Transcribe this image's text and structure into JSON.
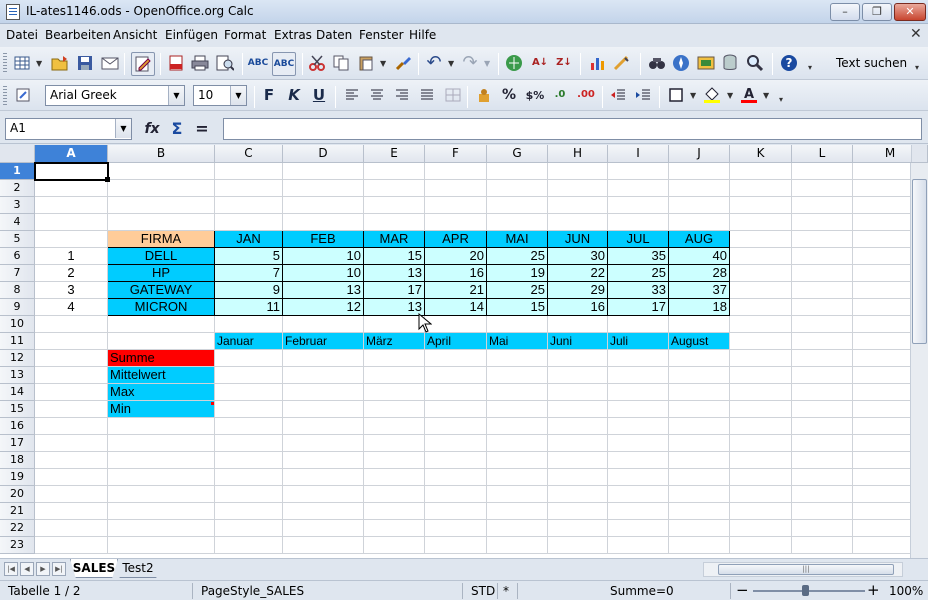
{
  "window": {
    "title": "IL-ates1146.ods - OpenOffice.org Calc",
    "minimize": "–",
    "maximize": "❐",
    "close": "✕"
  },
  "menu": {
    "items": [
      "Datei",
      "Bearbeiten",
      "Ansicht",
      "Einfügen",
      "Format",
      "Extras",
      "Daten",
      "Fenster",
      "Hilfe"
    ],
    "doc_close": "✕"
  },
  "toolbar1": {
    "find_label": "Text suchen",
    "icons": [
      "new-icon",
      "open-icon",
      "save-icon",
      "email-icon",
      "edit-file-icon",
      "export-pdf-icon",
      "print-icon",
      "page-preview-icon",
      "spellcheck-icon",
      "autospellcheck-icon",
      "cut-icon",
      "copy-icon",
      "paste-icon",
      "format-paintbrush-icon",
      "undo-icon",
      "redo-icon",
      "hyperlink-icon",
      "sort-ascending-icon",
      "sort-descending-icon",
      "chart-icon",
      "draw-functions-icon",
      "find-replace-icon",
      "navigator-icon",
      "gallery-icon",
      "data-sources-icon",
      "zoom-icon",
      "help-icon"
    ]
  },
  "toolbar2": {
    "font_name": "Arial Greek",
    "font_size": "10",
    "bold": "F",
    "italic": "K",
    "underline": "U",
    "percent": "%",
    "currency": "$%",
    "add_decimal": ".0",
    "del_decimal": ".00"
  },
  "formula_bar": {
    "name_box": "A1",
    "function_wizard": "fx",
    "sum": "Σ",
    "equals": "=",
    "input": ""
  },
  "grid": {
    "columns": [
      "A",
      "B",
      "C",
      "D",
      "E",
      "F",
      "G",
      "H",
      "I",
      "J",
      "K",
      "L",
      "M"
    ],
    "rows": [
      "1",
      "2",
      "3",
      "4",
      "5",
      "6",
      "7",
      "8",
      "9",
      "10",
      "11",
      "12",
      "13",
      "14",
      "15",
      "16",
      "17",
      "18",
      "19",
      "20",
      "21",
      "22",
      "23"
    ],
    "selected_column": "A",
    "selected_row": "1",
    "cells": {
      "B5": {
        "text": "FIRMA",
        "style": "firma",
        "align": "c"
      },
      "C5": {
        "text": "JAN",
        "style": "head",
        "align": "c"
      },
      "D5": {
        "text": "FEB",
        "style": "head",
        "align": "c"
      },
      "E5": {
        "text": "MAR",
        "style": "head",
        "align": "c"
      },
      "F5": {
        "text": "APR",
        "style": "head",
        "align": "c"
      },
      "G5": {
        "text": "MAI",
        "style": "head",
        "align": "c"
      },
      "H5": {
        "text": "JUN",
        "style": "head",
        "align": "c"
      },
      "I5": {
        "text": "JUL",
        "style": "head",
        "align": "c"
      },
      "J5": {
        "text": "AUG",
        "style": "head",
        "align": "c"
      },
      "A6": {
        "text": "1",
        "style": "",
        "align": "c"
      },
      "B6": {
        "text": "DELL",
        "style": "name",
        "align": "c"
      },
      "C6": {
        "text": "5",
        "style": "num",
        "align": "r"
      },
      "D6": {
        "text": "10",
        "style": "num",
        "align": "r"
      },
      "E6": {
        "text": "15",
        "style": "num",
        "align": "r"
      },
      "F6": {
        "text": "20",
        "style": "num",
        "align": "r"
      },
      "G6": {
        "text": "25",
        "style": "num",
        "align": "r"
      },
      "H6": {
        "text": "30",
        "style": "num",
        "align": "r"
      },
      "I6": {
        "text": "35",
        "style": "num",
        "align": "r"
      },
      "J6": {
        "text": "40",
        "style": "num",
        "align": "r"
      },
      "A7": {
        "text": "2",
        "style": "",
        "align": "c"
      },
      "B7": {
        "text": "HP",
        "style": "name",
        "align": "c"
      },
      "C7": {
        "text": "7",
        "style": "num",
        "align": "r"
      },
      "D7": {
        "text": "10",
        "style": "num",
        "align": "r"
      },
      "E7": {
        "text": "13",
        "style": "num",
        "align": "r"
      },
      "F7": {
        "text": "16",
        "style": "num",
        "align": "r"
      },
      "G7": {
        "text": "19",
        "style": "num",
        "align": "r"
      },
      "H7": {
        "text": "22",
        "style": "num",
        "align": "r"
      },
      "I7": {
        "text": "25",
        "style": "num",
        "align": "r"
      },
      "J7": {
        "text": "28",
        "style": "num",
        "align": "r"
      },
      "A8": {
        "text": "3",
        "style": "",
        "align": "c"
      },
      "B8": {
        "text": "GATEWAY",
        "style": "name",
        "align": "c"
      },
      "C8": {
        "text": "9",
        "style": "num",
        "align": "r"
      },
      "D8": {
        "text": "13",
        "style": "num",
        "align": "r"
      },
      "E8": {
        "text": "17",
        "style": "num",
        "align": "r"
      },
      "F8": {
        "text": "21",
        "style": "num",
        "align": "r"
      },
      "G8": {
        "text": "25",
        "style": "num",
        "align": "r"
      },
      "H8": {
        "text": "29",
        "style": "num",
        "align": "r"
      },
      "I8": {
        "text": "33",
        "style": "num",
        "align": "r"
      },
      "J8": {
        "text": "37",
        "style": "num",
        "align": "r"
      },
      "A9": {
        "text": "4",
        "style": "",
        "align": "c"
      },
      "B9": {
        "text": "MICRON",
        "style": "name",
        "align": "c"
      },
      "C9": {
        "text": "11",
        "style": "num",
        "align": "r"
      },
      "D9": {
        "text": "12",
        "style": "num",
        "align": "r"
      },
      "E9": {
        "text": "13",
        "style": "num",
        "align": "r"
      },
      "F9": {
        "text": "14",
        "style": "num",
        "align": "r"
      },
      "G9": {
        "text": "15",
        "style": "num",
        "align": "r"
      },
      "H9": {
        "text": "16",
        "style": "num",
        "align": "r"
      },
      "I9": {
        "text": "17",
        "style": "num",
        "align": "r"
      },
      "J9": {
        "text": "18",
        "style": "num",
        "align": "r"
      },
      "C11": {
        "text": "Januar",
        "style": "month",
        "align": "l"
      },
      "D11": {
        "text": "Februar",
        "style": "month",
        "align": "l"
      },
      "E11": {
        "text": "März",
        "style": "month",
        "align": "l"
      },
      "F11": {
        "text": "April",
        "style": "month",
        "align": "l"
      },
      "G11": {
        "text": "Mai",
        "style": "month",
        "align": "l"
      },
      "H11": {
        "text": "Juni",
        "style": "month",
        "align": "l"
      },
      "I11": {
        "text": "Juli",
        "style": "month",
        "align": "l"
      },
      "J11": {
        "text": "August",
        "style": "month",
        "align": "l"
      },
      "B12": {
        "text": "Summe",
        "style": "red",
        "align": "l"
      },
      "B13": {
        "text": "Mittelwert",
        "style": "blue",
        "align": "l"
      },
      "B14": {
        "text": "Max",
        "style": "blue",
        "align": "l"
      },
      "B15": {
        "text": "Min",
        "style": "blue",
        "align": "l"
      }
    }
  },
  "sheet_tabs": {
    "tabs": [
      "SALES",
      "Test2"
    ],
    "active": "SALES"
  },
  "status_bar": {
    "sheet": "Tabelle 1 / 2",
    "page_style": "PageStyle_SALES",
    "mode": "STD",
    "modified": "*",
    "sum": "Summe=0",
    "zoom": "100%",
    "zoom_out": "−",
    "zoom_in": "+"
  },
  "colors": {
    "header_cyan": "#00ccff",
    "firma_orange": "#ffcc99",
    "number_light": "#ccffff",
    "summe_red": "#ff0000",
    "selection_blue": "#3e82d8"
  }
}
